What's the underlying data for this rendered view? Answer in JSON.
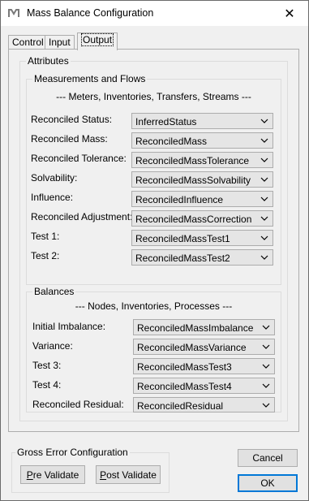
{
  "window": {
    "title": "Mass Balance Configuration",
    "close_glyph": "✕"
  },
  "tabs": [
    {
      "label": "Control",
      "active": false
    },
    {
      "label": "Input",
      "active": false
    },
    {
      "label": "Output",
      "active": true
    }
  ],
  "attributes": {
    "title": "Attributes",
    "measurements": {
      "title": "Measurements and Flows",
      "caption": "--- Meters, Inventories, Transfers, Streams ---",
      "rows": [
        {
          "label": "Reconciled Status:",
          "value": "InferredStatus"
        },
        {
          "label": "Reconciled Mass:",
          "value": "ReconciledMass"
        },
        {
          "label": "Reconciled Tolerance:",
          "value": "ReconciledMassTolerance"
        },
        {
          "label": "Solvability:",
          "value": "ReconciledMassSolvability"
        },
        {
          "label": "Influence:",
          "value": "ReconciledInfluence"
        },
        {
          "label": "Reconciled Adjustment:",
          "value": "ReconciledMassCorrection"
        },
        {
          "label": "Test 1:",
          "value": "ReconciledMassTest1"
        },
        {
          "label": "Test 2:",
          "value": "ReconciledMassTest2"
        }
      ]
    },
    "balances": {
      "title": "Balances",
      "caption": "--- Nodes, Inventories, Processes ---",
      "rows": [
        {
          "label": "Initial Imbalance:",
          "value": "ReconciledMassImbalance"
        },
        {
          "label": "Variance:",
          "value": "ReconciledMassVariance"
        },
        {
          "label": "Test 3:",
          "value": "ReconciledMassTest3"
        },
        {
          "label": "Test 4:",
          "value": "ReconciledMassTest4"
        },
        {
          "label": "Reconciled Residual:",
          "value": "ReconciledResidual"
        }
      ]
    }
  },
  "gross_error": {
    "title": "Gross Error Configuration",
    "pre_validate": {
      "mnemonic": "P",
      "rest": "re Validate"
    },
    "post_validate": {
      "mnemonic": "P",
      "rest": "ost Validate"
    }
  },
  "buttons": {
    "cancel": "Cancel",
    "ok": "OK"
  },
  "colors": {
    "accent": "#0078d7",
    "panel": "#f0f0f0",
    "combo_bg": "#e5e5e5"
  },
  "icons": {
    "app": "mass-balance-logo-icon",
    "close": "close-icon",
    "dropdown": "chevron-down-icon"
  }
}
